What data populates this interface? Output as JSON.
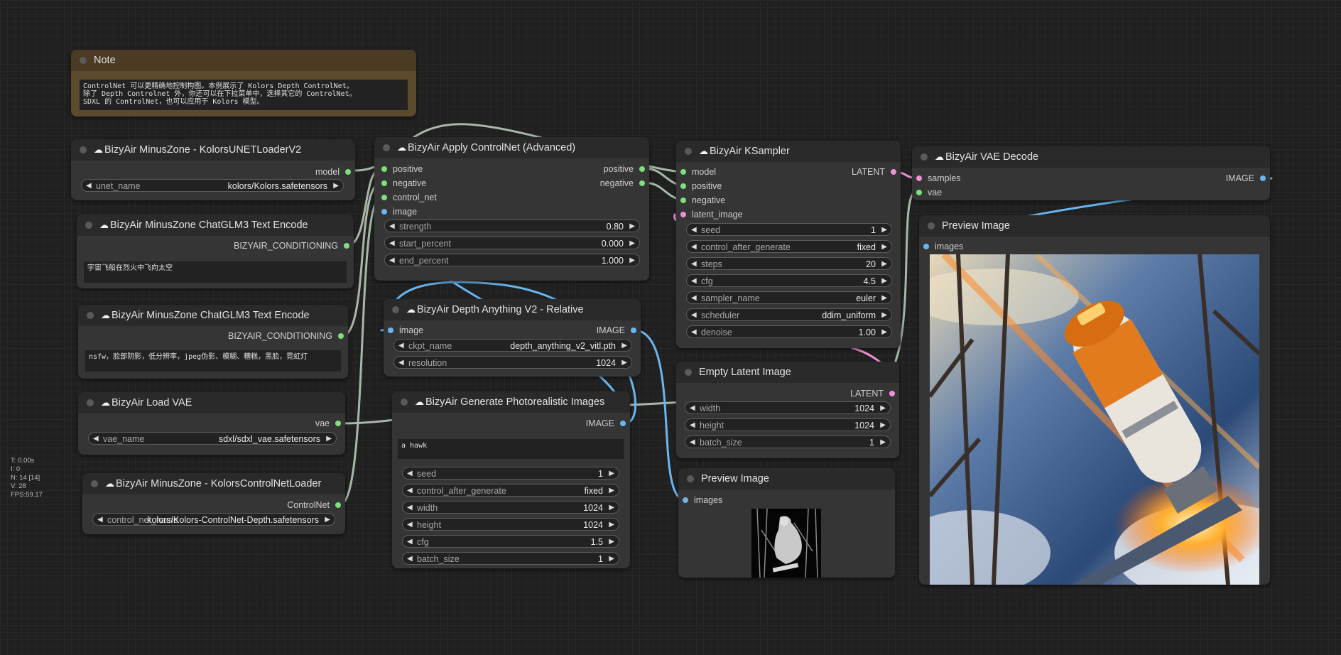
{
  "note": {
    "title": "Note",
    "text": "ControlNet 可以更精确地控制构图。本例展示了 Kolors Depth ControlNet。\n除了 Depth Controlnet 外，你还可以在下拉菜单中，选择其它的 ControlNet。\nSDXL 的 ControlNet，也可以应用于 Kolors 模型。"
  },
  "unet_loader": {
    "title": "BizyAir MinusZone - KolorsUNETLoaderV2",
    "out": "model",
    "w_label": "unet_name",
    "w_value": "kolors/Kolors.safetensors"
  },
  "text_encode_pos": {
    "title": "BizyAir MinusZone ChatGLM3 Text Encode",
    "out": "BIZYAIR_CONDITIONING",
    "text": "宇宙飞船在烈火中飞向太空"
  },
  "text_encode_neg": {
    "title": "BizyAir MinusZone ChatGLM3 Text Encode",
    "out": "BIZYAIR_CONDITIONING",
    "text": "nsfw，脸部阴影，低分辨率，jpeg伪影、模糊、糟糕，黑脸，霓虹灯"
  },
  "load_vae": {
    "title": "BizyAir Load VAE",
    "out": "vae",
    "w_label": "vae_name",
    "w_value": "sdxl/sdxl_vae.safetensors"
  },
  "controlnet_loader": {
    "title": "BizyAir MinusZone - KolorsControlNetLoader",
    "out": "ControlNet",
    "w_label": "control_net_name",
    "w_value": "kolors/Kolors-ControlNet-Depth.safetensors"
  },
  "apply_controlnet": {
    "title": "BizyAir Apply ControlNet (Advanced)",
    "inputs": [
      "positive",
      "negative",
      "control_net",
      "image"
    ],
    "outputs": [
      "positive",
      "negative"
    ],
    "widgets": [
      {
        "label": "strength",
        "value": "0.80"
      },
      {
        "label": "start_percent",
        "value": "0.000"
      },
      {
        "label": "end_percent",
        "value": "1.000"
      }
    ]
  },
  "depth_anything": {
    "title": "BizyAir Depth Anything V2 - Relative",
    "input": "image",
    "output": "IMAGE",
    "widgets": [
      {
        "label": "ckpt_name",
        "value": "depth_anything_v2_vitl.pth"
      },
      {
        "label": "resolution",
        "value": "1024"
      }
    ]
  },
  "generate": {
    "title": "BizyAir Generate Photorealistic Images",
    "output": "IMAGE",
    "prompt": "a hawk",
    "widgets": [
      {
        "label": "seed",
        "value": "1"
      },
      {
        "label": "control_after_generate",
        "value": "fixed"
      },
      {
        "label": "width",
        "value": "1024"
      },
      {
        "label": "height",
        "value": "1024"
      },
      {
        "label": "cfg",
        "value": "1.5"
      },
      {
        "label": "batch_size",
        "value": "1"
      }
    ]
  },
  "ksampler": {
    "title": "BizyAir KSampler",
    "inputs": [
      "model",
      "positive",
      "negative",
      "latent_image"
    ],
    "output": "LATENT",
    "widgets": [
      {
        "label": "seed",
        "value": "1"
      },
      {
        "label": "control_after_generate",
        "value": "fixed"
      },
      {
        "label": "steps",
        "value": "20"
      },
      {
        "label": "cfg",
        "value": "4.5"
      },
      {
        "label": "sampler_name",
        "value": "euler"
      },
      {
        "label": "scheduler",
        "value": "ddim_uniform"
      },
      {
        "label": "denoise",
        "value": "1.00"
      }
    ]
  },
  "empty_latent": {
    "title": "Empty Latent Image",
    "output": "LATENT",
    "widgets": [
      {
        "label": "width",
        "value": "1024"
      },
      {
        "label": "height",
        "value": "1024"
      },
      {
        "label": "batch_size",
        "value": "1"
      }
    ]
  },
  "vae_decode": {
    "title": "BizyAir VAE Decode",
    "inputs": [
      "samples",
      "vae"
    ],
    "output": "IMAGE"
  },
  "preview_small": {
    "title": "Preview Image",
    "input": "images"
  },
  "preview_large": {
    "title": "Preview Image",
    "input": "images"
  },
  "stats": [
    "T: 0.00s",
    "I: 0",
    "N: 14 [14]",
    "V: 28",
    "FPS:59.17"
  ],
  "colors": {
    "conditioning": "#7fdf7f",
    "latent": "#f090d8",
    "image": "#69b7f0",
    "wire_grey": "#9aab9a",
    "note_body": "#5b4a2c"
  },
  "icons": {
    "arrow_left": "◀",
    "arrow_right": "▶",
    "cloud": "☁"
  }
}
